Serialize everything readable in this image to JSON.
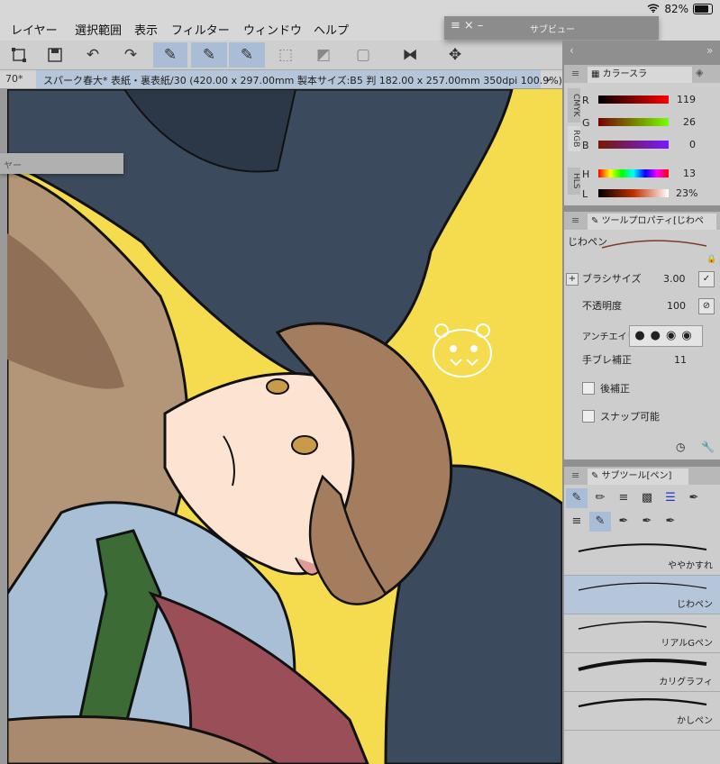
{
  "status": {
    "battery": "82%"
  },
  "menu": [
    "レイヤー",
    "選択範囲",
    "表示",
    "フィルター",
    "ウィンドウ",
    "ヘルプ"
  ],
  "subviewer": {
    "title": "サブビュー"
  },
  "document": {
    "zoom": "70*",
    "title": "スパーク春大* 表紙・裏表紙/30 (420.00 x 297.00mm 製本サイズ:B5 判 182.00 x 257.00mm 350dpi 100.9%)"
  },
  "layer_panel": {
    "label": "ヤー"
  },
  "color_panel": {
    "tab": "カラースラ",
    "mode_tabs": [
      "CMYK",
      "RGB",
      "HLS"
    ],
    "sliders": [
      {
        "label": "R",
        "value": "119"
      },
      {
        "label": "G",
        "value": "26"
      },
      {
        "label": "B",
        "value": "0"
      },
      {
        "label": "H",
        "value": "13"
      },
      {
        "label": "L",
        "value": "23%"
      }
    ]
  },
  "tool_property": {
    "tab": "ツールプロパティ[じわペ",
    "tool_name": "じわペン",
    "brush_size_label": "ブラシサイズ",
    "brush_size": "3.00",
    "opacity_label": "不透明度",
    "opacity": "100",
    "antialias_label": "アンチエイリ",
    "stabilization_label": "手ブレ補正",
    "stabilization": "11",
    "post_correction_label": "後補正",
    "snap_label": "スナップ可能"
  },
  "subtool": {
    "tab": "サブツール[ペン]",
    "brushes": [
      "ややかすれ",
      "じわペン",
      "リアルGペン",
      "カリグラフィ",
      "かしペン"
    ],
    "selected": "じわペン"
  },
  "colors": {
    "canvas_bg": "#f5dc4e",
    "selection": "#b6c6da",
    "current_color": "#771a00"
  }
}
